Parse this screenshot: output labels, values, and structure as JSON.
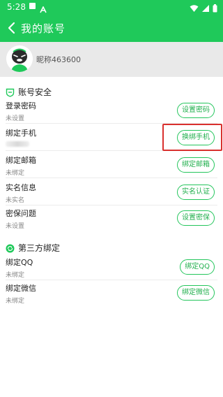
{
  "status_bar": {
    "time": "5:28"
  },
  "app_bar": {
    "title": "我的账号"
  },
  "profile": {
    "nickname": "昵称463600"
  },
  "sections": {
    "security": {
      "title": "账号安全"
    },
    "third_party": {
      "title": "第三方绑定"
    }
  },
  "rows": [
    {
      "title": "登录密码",
      "subtitle": "未设置",
      "button": "设置密码"
    },
    {
      "title": "绑定手机",
      "subtitle": "",
      "button": "换绑手机"
    },
    {
      "title": "绑定邮箱",
      "subtitle": "未绑定",
      "button": "绑定邮箱"
    },
    {
      "title": "实名信息",
      "subtitle": "未实名",
      "button": "实名认证"
    },
    {
      "title": "密保问题",
      "subtitle": "未设置",
      "button": "设置密保"
    },
    {
      "title": "绑定QQ",
      "subtitle": "未绑定",
      "button": "绑定QQ"
    },
    {
      "title": "绑定微信",
      "subtitle": "未绑定",
      "button": "绑定微信"
    }
  ],
  "colors": {
    "brand": "#1fc95a",
    "accent_border": "#23c55b",
    "highlight": "#d9302e"
  }
}
